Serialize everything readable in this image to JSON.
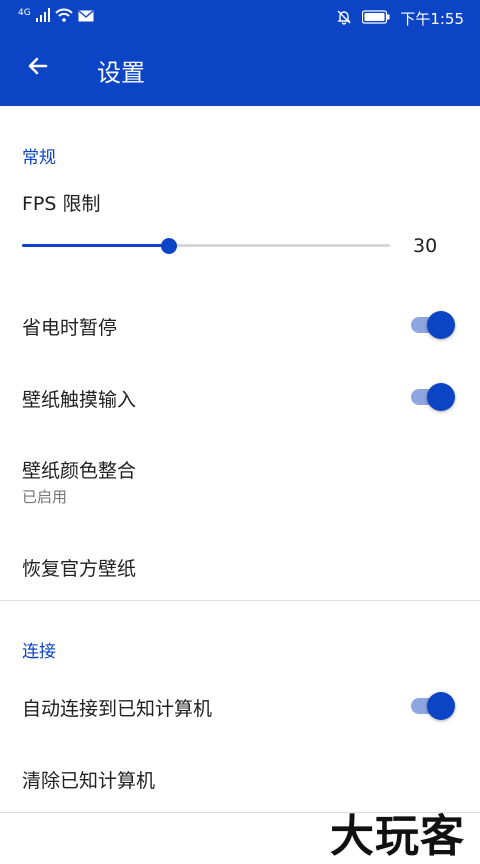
{
  "status_bar": {
    "network": "4G",
    "time": "下午1:55"
  },
  "toolbar": {
    "title": "设置",
    "back_icon": "arrow-back-icon"
  },
  "sections": {
    "general": {
      "header": "常规",
      "fps_limit": {
        "label": "FPS 限制",
        "value": "30",
        "fraction": 0.4
      },
      "pause_on_battery_saver": {
        "label": "省电时暂停",
        "enabled": true
      },
      "wallpaper_touch_input": {
        "label": "壁纸触摸输入",
        "enabled": true
      },
      "wallpaper_color_integration": {
        "label": "壁纸颜色整合",
        "summary": "已启用"
      },
      "restore_official_wallpaper": {
        "label": "恢复官方壁纸"
      }
    },
    "connection": {
      "header": "连接",
      "auto_connect": {
        "label": "自动连接到已知计算机",
        "enabled": true
      },
      "clear_known": {
        "label": "清除已知计算机"
      }
    }
  },
  "watermark": "大玩客",
  "colors": {
    "accent": "#0b44c4",
    "switch_track": "#8ea6e0",
    "divider": "#dcdcdc"
  }
}
